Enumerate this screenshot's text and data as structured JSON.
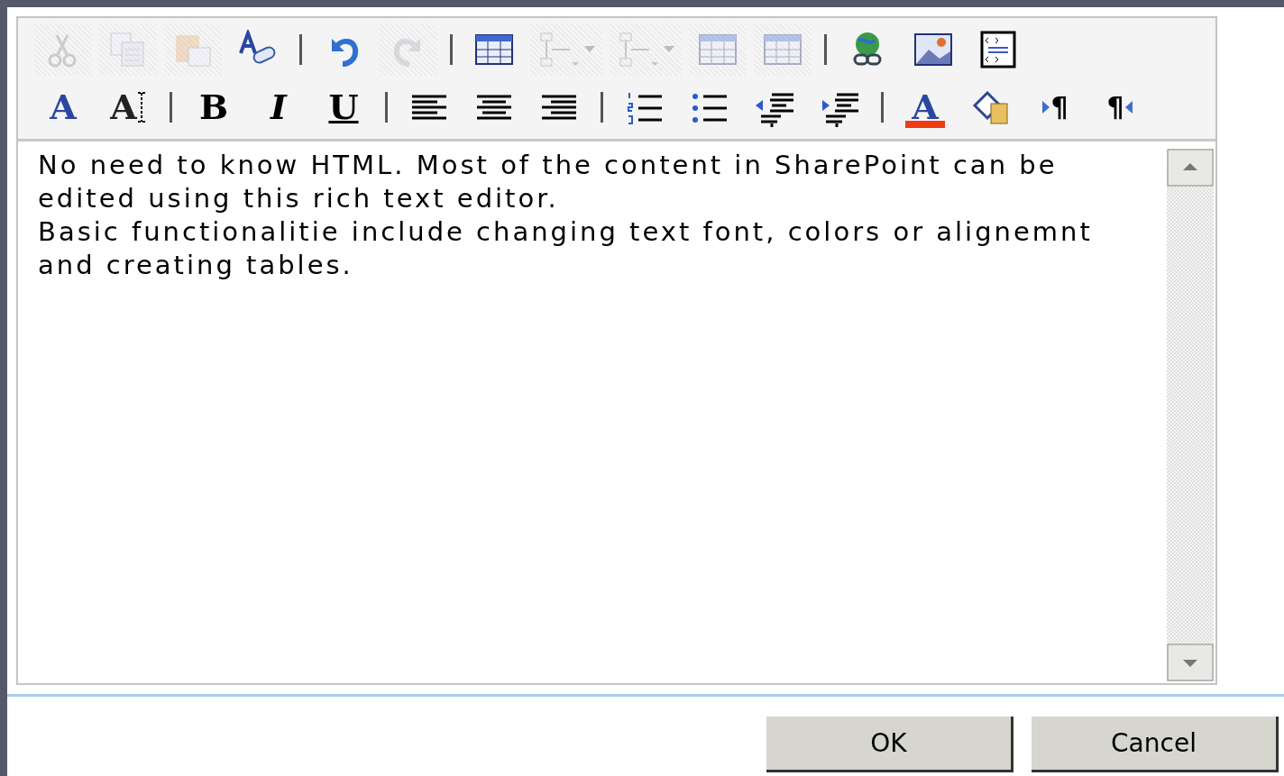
{
  "toolbar": {
    "rows": [
      [
        {
          "kind": "button",
          "disabled": true
        },
        {
          "kind": "button",
          "disabled": true
        },
        {
          "kind": "button",
          "disabled": true
        },
        {
          "kind": "button",
          "disabled": false
        },
        {
          "kind": "separator"
        },
        {
          "kind": "button",
          "disabled": false
        },
        {
          "kind": "button",
          "disabled": true
        },
        {
          "kind": "separator"
        },
        {
          "kind": "button",
          "disabled": false
        },
        {
          "kind": "dropdown",
          "disabled": true
        },
        {
          "kind": "dropdown",
          "disabled": true
        },
        {
          "kind": "button",
          "disabled": true
        },
        {
          "kind": "button",
          "disabled": true
        },
        {
          "kind": "separator"
        },
        {
          "kind": "button",
          "disabled": false
        },
        {
          "kind": "button",
          "disabled": false
        },
        {
          "kind": "button",
          "disabled": false
        }
      ],
      [
        {
          "kind": "glyph",
          "label": "A",
          "disabled": false
        },
        {
          "kind": "glyph",
          "label": "A",
          "disabled": false
        },
        {
          "kind": "separator"
        },
        {
          "kind": "glyph",
          "label": "B",
          "disabled": false
        },
        {
          "kind": "glyph",
          "label": "I",
          "disabled": false
        },
        {
          "kind": "glyph",
          "label": "U",
          "disabled": false
        },
        {
          "kind": "separator"
        },
        {
          "kind": "button",
          "disabled": false
        },
        {
          "kind": "button",
          "disabled": false
        },
        {
          "kind": "button",
          "disabled": false
        },
        {
          "kind": "separator"
        },
        {
          "kind": "button",
          "disabled": false
        },
        {
          "kind": "button",
          "disabled": false
        },
        {
          "kind": "button",
          "disabled": false
        },
        {
          "kind": "button",
          "disabled": false
        },
        {
          "kind": "separator"
        },
        {
          "kind": "glyph",
          "label": "A",
          "disabled": false
        },
        {
          "kind": "button",
          "disabled": false
        },
        {
          "kind": "glyph",
          "label": "¶",
          "disabled": false
        },
        {
          "kind": "glyph",
          "label": "¶",
          "disabled": false
        }
      ]
    ]
  },
  "editor": {
    "paragraphs": [
      "No need to know HTML. Most of the content in SharePoint can be edited using this rich text editor.",
      "Basic functionalitie include changing text font, colors or alignemnt and creating tables."
    ]
  },
  "buttons": [
    {
      "label": "OK"
    },
    {
      "label": "Cancel"
    }
  ]
}
